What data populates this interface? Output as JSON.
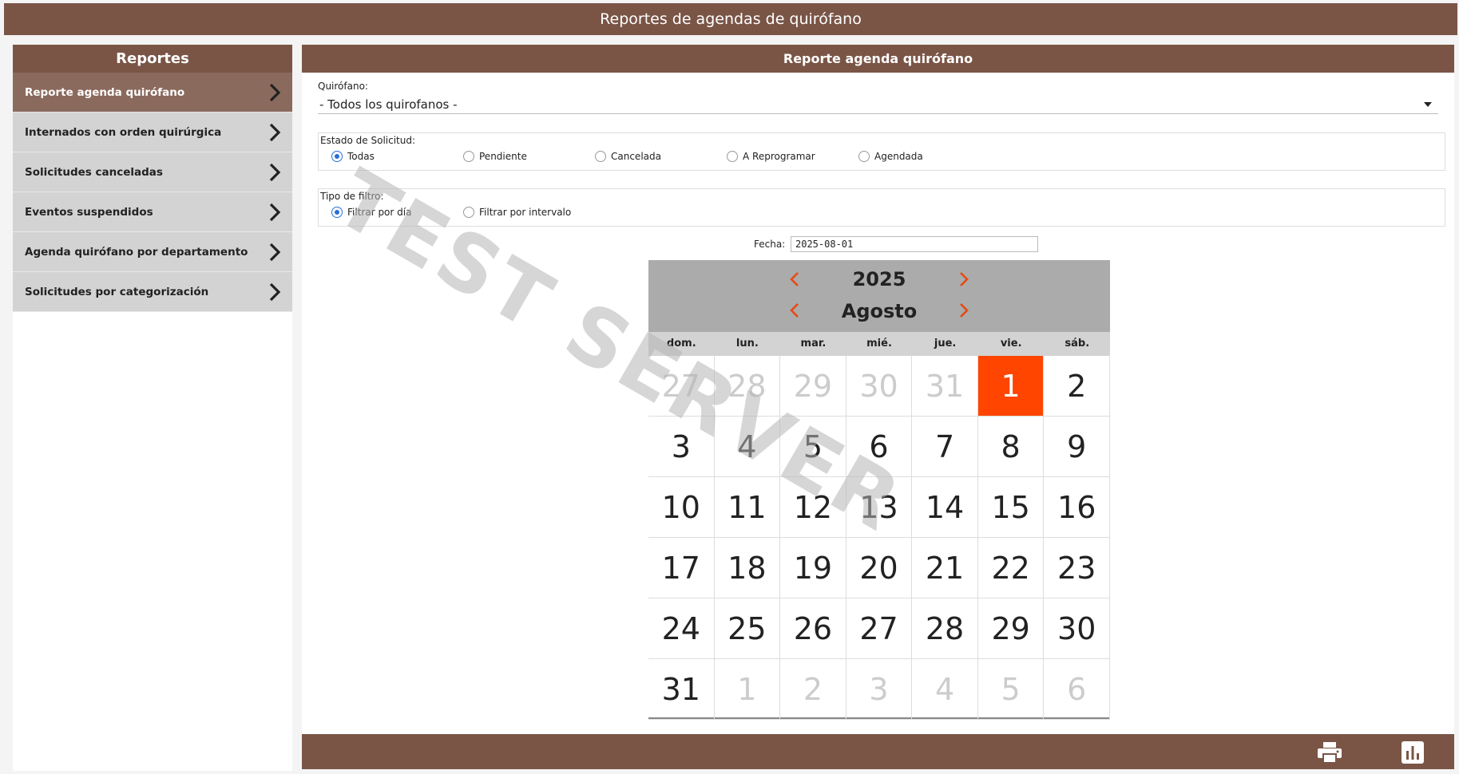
{
  "app": {
    "title": "Reportes de agendas de quirófano"
  },
  "sidebar": {
    "title": "Reportes",
    "items": [
      {
        "label": "Reporte agenda quirófano",
        "active": true
      },
      {
        "label": "Internados con orden quirúrgica"
      },
      {
        "label": "Solicitudes canceladas"
      },
      {
        "label": "Eventos suspendidos"
      },
      {
        "label": "Agenda quirófano por departamento"
      },
      {
        "label": "Solicitudes por categorización"
      }
    ]
  },
  "main": {
    "title": "Reporte agenda quirófano",
    "quirofano": {
      "label": "Quirófano:",
      "value": "- Todos los quirofanos -"
    },
    "estado": {
      "label": "Estado de Solicitud:",
      "options": [
        "Todas",
        "Pendiente",
        "Cancelada",
        "A Reprogramar",
        "Agendada"
      ],
      "selected": "Todas"
    },
    "filtro": {
      "label": "Tipo de filtro:",
      "options": [
        "Filtrar por día",
        "Filtrar por intervalo"
      ],
      "selected": "Filtrar por día"
    },
    "fecha": {
      "label": "Fecha:",
      "value": "2025-08-01"
    }
  },
  "calendar": {
    "year": "2025",
    "month": "Agosto",
    "weekdays": [
      "dom.",
      "lun.",
      "mar.",
      "mié.",
      "jue.",
      "vie.",
      "sáb."
    ],
    "days": [
      {
        "d": "27",
        "other": true
      },
      {
        "d": "28",
        "other": true
      },
      {
        "d": "29",
        "other": true
      },
      {
        "d": "30",
        "other": true
      },
      {
        "d": "31",
        "other": true
      },
      {
        "d": "1",
        "selected": true
      },
      {
        "d": "2"
      },
      {
        "d": "3"
      },
      {
        "d": "4"
      },
      {
        "d": "5"
      },
      {
        "d": "6"
      },
      {
        "d": "7"
      },
      {
        "d": "8"
      },
      {
        "d": "9"
      },
      {
        "d": "10"
      },
      {
        "d": "11"
      },
      {
        "d": "12"
      },
      {
        "d": "13"
      },
      {
        "d": "14"
      },
      {
        "d": "15"
      },
      {
        "d": "16"
      },
      {
        "d": "17"
      },
      {
        "d": "18"
      },
      {
        "d": "19"
      },
      {
        "d": "20"
      },
      {
        "d": "21"
      },
      {
        "d": "22"
      },
      {
        "d": "23"
      },
      {
        "d": "24"
      },
      {
        "d": "25"
      },
      {
        "d": "26"
      },
      {
        "d": "27"
      },
      {
        "d": "28"
      },
      {
        "d": "29"
      },
      {
        "d": "30"
      },
      {
        "d": "31"
      },
      {
        "d": "1",
        "other": true
      },
      {
        "d": "2",
        "other": true
      },
      {
        "d": "3",
        "other": true
      },
      {
        "d": "4",
        "other": true
      },
      {
        "d": "5",
        "other": true
      },
      {
        "d": "6",
        "other": true
      }
    ]
  },
  "watermark": "TEST SERVER",
  "colors": {
    "brand": "#7a5546",
    "accent": "#ff4500",
    "nav": "#e54a14",
    "radio": "#2a6ed8"
  },
  "footer": {
    "icons": [
      "print-icon",
      "bar-chart-icon"
    ]
  }
}
